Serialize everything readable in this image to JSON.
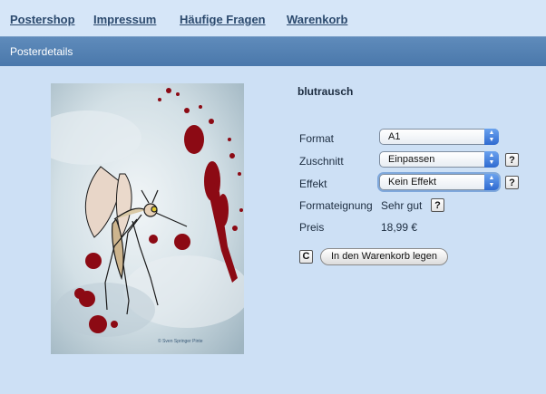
{
  "nav": {
    "items": [
      "Postershop",
      "Impressum",
      "Häufige Fragen",
      "Warenkorb"
    ]
  },
  "section_title": "Posterdetails",
  "product": {
    "title": "blutrausch",
    "poster_credit": "© Sven Springer Pinte"
  },
  "fields": {
    "format_label": "Format",
    "format_value": "A1",
    "zuschnitt_label": "Zuschnitt",
    "zuschnitt_value": "Einpassen",
    "effekt_label": "Effekt",
    "effekt_value": "Kein Effekt",
    "eignung_label": "Formateignung",
    "eignung_value": "Sehr gut",
    "preis_label": "Preis",
    "preis_value": "18,99 €"
  },
  "help_glyph": "?",
  "cart_button": "In den Warenkorb legen",
  "colors": {
    "nav_bg": "#d6e6f8",
    "title_bar": "#4a78ab",
    "content_bg": "#cde0f5",
    "link": "#2c4a6e",
    "blood": "#8c0a14"
  }
}
